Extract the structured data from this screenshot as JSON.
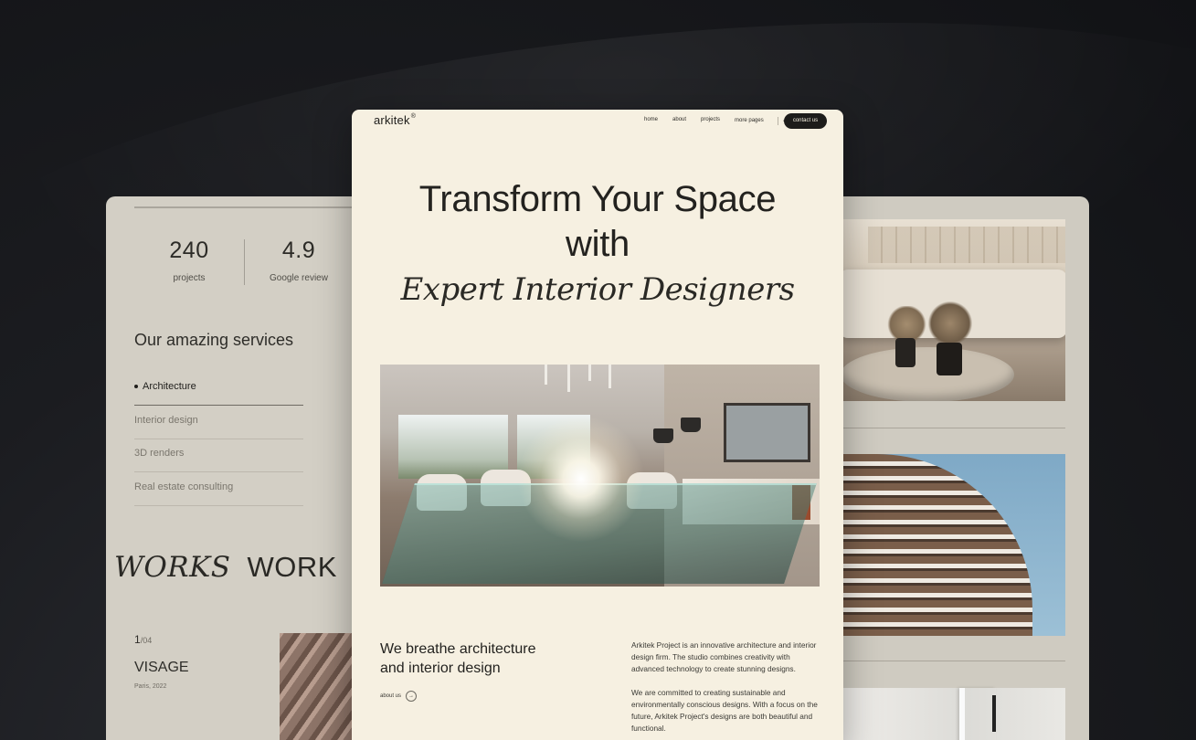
{
  "left_card": {
    "stats": [
      {
        "number": "240",
        "label": "projects"
      },
      {
        "number": "4.9",
        "label": "Google review"
      }
    ],
    "services_title": "Our amazing services",
    "services": [
      "Architecture",
      "Interior design",
      "3D renders",
      "Real estate consulting"
    ],
    "works_italic": "WORKS",
    "works_plain": "WORK",
    "project": {
      "index": "1",
      "total": "/04",
      "name": "VISAGE",
      "meta": "Paris, 2022"
    }
  },
  "center_card": {
    "logo": "arkitek",
    "logo_mark": "®",
    "nav": [
      "home",
      "about",
      "projects",
      "more pages"
    ],
    "nav_more_chevron": "⌄",
    "contact_button": "contact us",
    "hero": {
      "line1": "Transform Your Space",
      "line2": "with",
      "line3": "Expert Interior Designers"
    },
    "intro_heading_line1": "We breathe architecture",
    "intro_heading_line2": "and interior design",
    "about_link": "about us",
    "about_arrow": "→",
    "description": [
      "Arkitek Project is an innovative architecture and interior design firm. The studio combines creativity with advanced technology to create stunning designs.",
      "We are committed to creating sustainable and environmentally conscious designs. With a focus on the future, Arkitek Project's designs are both beautiful and functional."
    ]
  },
  "colors": {
    "background": "#16171a",
    "center_card_bg": "#f6f0e1",
    "side_card_bg": "#d3cfc5",
    "button_bg": "#1d1c1a"
  }
}
